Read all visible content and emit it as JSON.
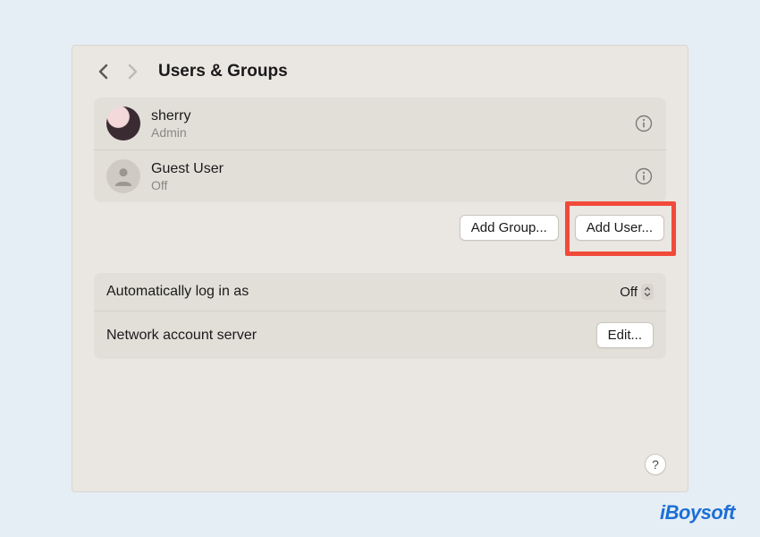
{
  "header": {
    "title": "Users & Groups"
  },
  "users": [
    {
      "name": "sherry",
      "role": "Admin"
    },
    {
      "name": "Guest User",
      "role": "Off"
    }
  ],
  "actions": {
    "add_group_label": "Add Group...",
    "add_user_label": "Add User..."
  },
  "settings": {
    "auto_login_label": "Automatically log in as",
    "auto_login_value": "Off",
    "network_server_label": "Network account server",
    "edit_label": "Edit..."
  },
  "help_label": "?",
  "watermark": "iBoysoft",
  "colors": {
    "highlight": "#f14a3a",
    "brand": "#1b6fd6"
  }
}
